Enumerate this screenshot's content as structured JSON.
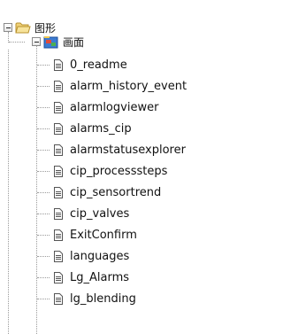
{
  "tree": {
    "root": {
      "label": "图形",
      "icon": "folder-icon",
      "expanded": true
    },
    "child": {
      "label": "画面",
      "icon": "screens-folder-icon",
      "expanded": true
    },
    "items": [
      {
        "label": "0_readme",
        "icon": "document-icon"
      },
      {
        "label": "alarm_history_event",
        "icon": "document-icon"
      },
      {
        "label": "alarmlogviewer",
        "icon": "document-icon"
      },
      {
        "label": "alarms_cip",
        "icon": "document-icon"
      },
      {
        "label": "alarmstatusexplorer",
        "icon": "document-icon"
      },
      {
        "label": "cip_processsteps",
        "icon": "document-icon"
      },
      {
        "label": "cip_sensortrend",
        "icon": "document-icon"
      },
      {
        "label": "cip_valves",
        "icon": "document-icon"
      },
      {
        "label": "ExitConfirm",
        "icon": "document-icon"
      },
      {
        "label": "languages",
        "icon": "document-icon"
      },
      {
        "label": "Lg_Alarms",
        "icon": "document-icon"
      },
      {
        "label": "lg_blending",
        "icon": "document-icon"
      }
    ]
  }
}
